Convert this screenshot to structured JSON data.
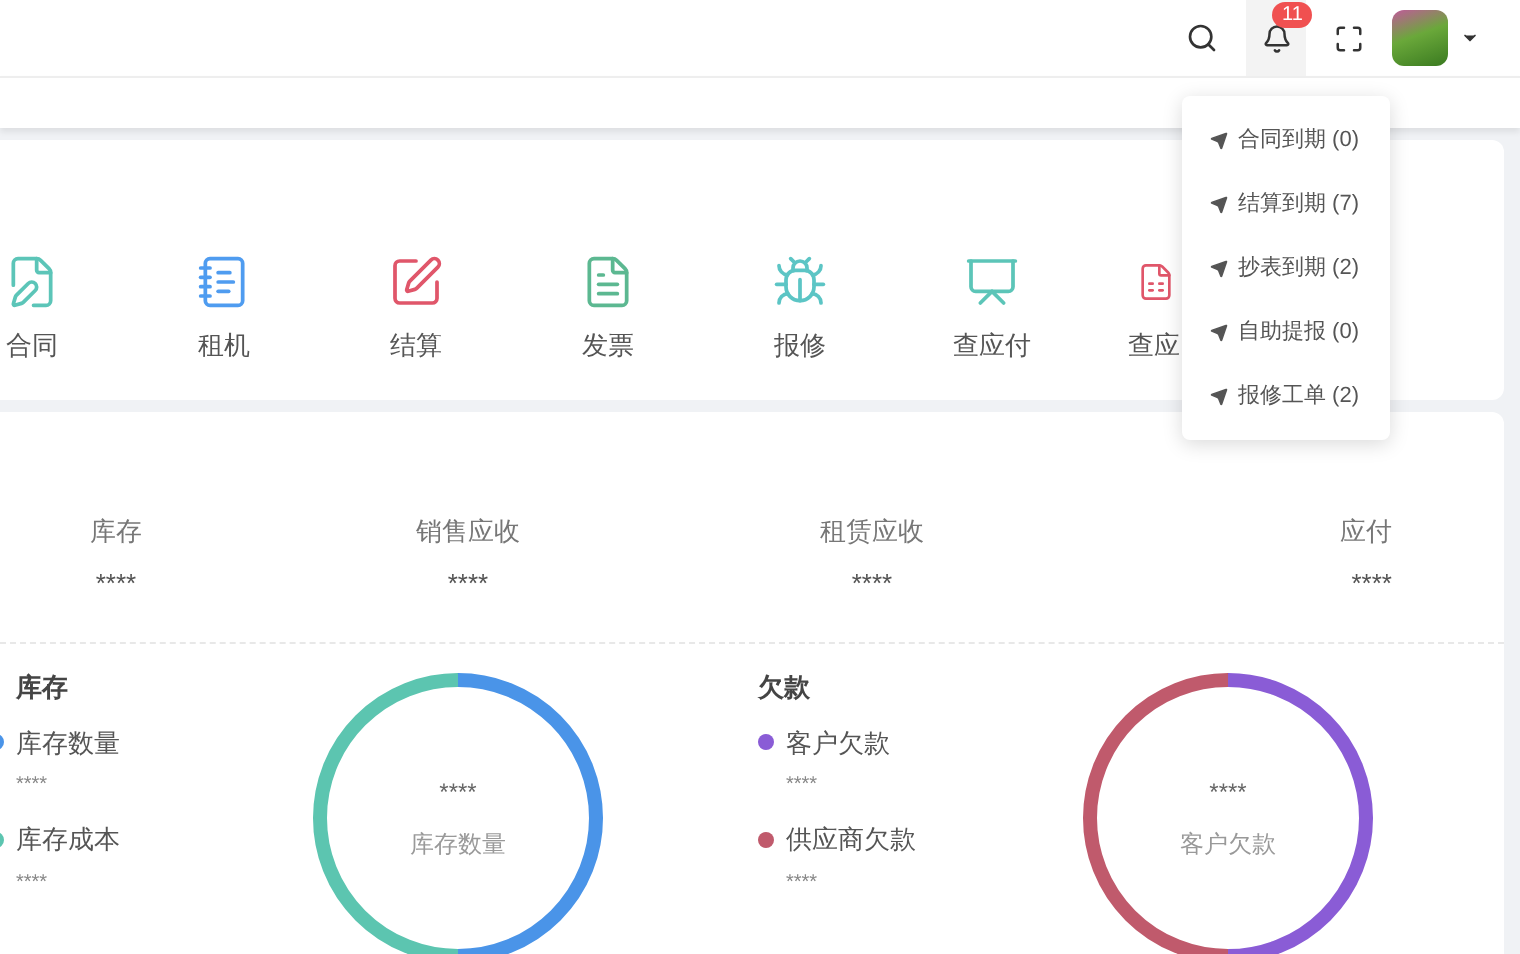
{
  "header": {
    "notification_count": "11",
    "notifications": [
      {
        "label": "合同到期 (0)"
      },
      {
        "label": "结算到期 (7)"
      },
      {
        "label": "抄表到期 (2)"
      },
      {
        "label": "自助提报 (0)"
      },
      {
        "label": "报修工单 (2)"
      }
    ]
  },
  "shortcuts": [
    {
      "kind": "contract",
      "label": "合同",
      "color": "#5cc5b8"
    },
    {
      "kind": "rent",
      "label": "租机",
      "color": "#4f9cf0"
    },
    {
      "kind": "settle",
      "label": "结算",
      "color": "#e0566a"
    },
    {
      "kind": "invoice",
      "label": "发票",
      "color": "#5cb891"
    },
    {
      "kind": "repair",
      "label": "报修",
      "color": "#5cc5c5"
    },
    {
      "kind": "payable",
      "label": "查应付",
      "color": "#5cc5b8"
    },
    {
      "kind": "receivable",
      "label": "查应",
      "color": "#e0566a"
    }
  ],
  "stats": [
    {
      "label": "库存",
      "value": "****"
    },
    {
      "label": "销售应收",
      "value": "****"
    },
    {
      "label": "租赁应收",
      "value": "****"
    },
    {
      "label": "应付",
      "value": "****"
    }
  ],
  "summaries": [
    {
      "title": "库存",
      "items": [
        {
          "label": "库存数量",
          "value": "****",
          "color": "#4a94e8"
        },
        {
          "label": "库存成本",
          "value": "****",
          "color": "#5cc5b0"
        }
      ],
      "donut": {
        "value": "****",
        "label": "库存数量"
      }
    },
    {
      "title": "欠款",
      "items": [
        {
          "label": "客户欠款",
          "value": "****",
          "color": "#8a5cd6"
        },
        {
          "label": "供应商欠款",
          "value": "****",
          "color": "#c05a6c"
        }
      ],
      "donut": {
        "value": "****",
        "label": "客户欠款"
      }
    }
  ]
}
